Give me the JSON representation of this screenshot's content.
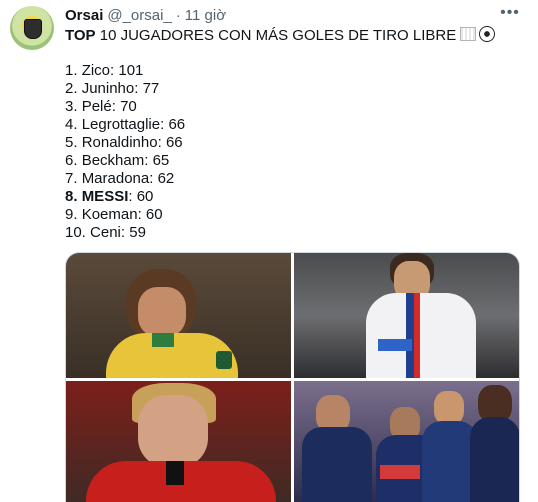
{
  "tweet": {
    "author_name": "Orsai",
    "handle": "@_orsai_",
    "separator": "·",
    "time": "11 giờ",
    "more_glyph": "•••",
    "headline_bold": "TOP",
    "headline_rest": " 10 JUGADORES CON MÁS GOLES DE TIRO LIBRE"
  },
  "ranking": [
    {
      "pos": "1.",
      "player": "Zico",
      "goals": "101"
    },
    {
      "pos": "2.",
      "player": "Juninho",
      "goals": "77"
    },
    {
      "pos": "3.",
      "player": "Pelé",
      "goals": "70"
    },
    {
      "pos": "4.",
      "player": "Legrottaglie",
      "goals": "66"
    },
    {
      "pos": "5.",
      "player": "Ronaldinho",
      "goals": "66"
    },
    {
      "pos": "6.",
      "player": "Beckham",
      "goals": "65"
    },
    {
      "pos": "7.",
      "player": "Maradona",
      "goals": "62"
    },
    {
      "pos": "8.",
      "player": "MESSI",
      "goals": "60",
      "bold": true
    },
    {
      "pos": "9.",
      "player": "Koeman",
      "goals": "60"
    },
    {
      "pos": "10.",
      "player": "Ceni",
      "goals": "59"
    }
  ],
  "media": {
    "photos": [
      {
        "name": "photo-yellow-jersey-player"
      },
      {
        "name": "photo-white-jersey-player"
      },
      {
        "name": "photo-red-jersey-player"
      },
      {
        "name": "photo-team-celebration"
      }
    ]
  },
  "colors": {
    "text": "#0f1419",
    "muted": "#536471",
    "border": "#cfd9de"
  }
}
